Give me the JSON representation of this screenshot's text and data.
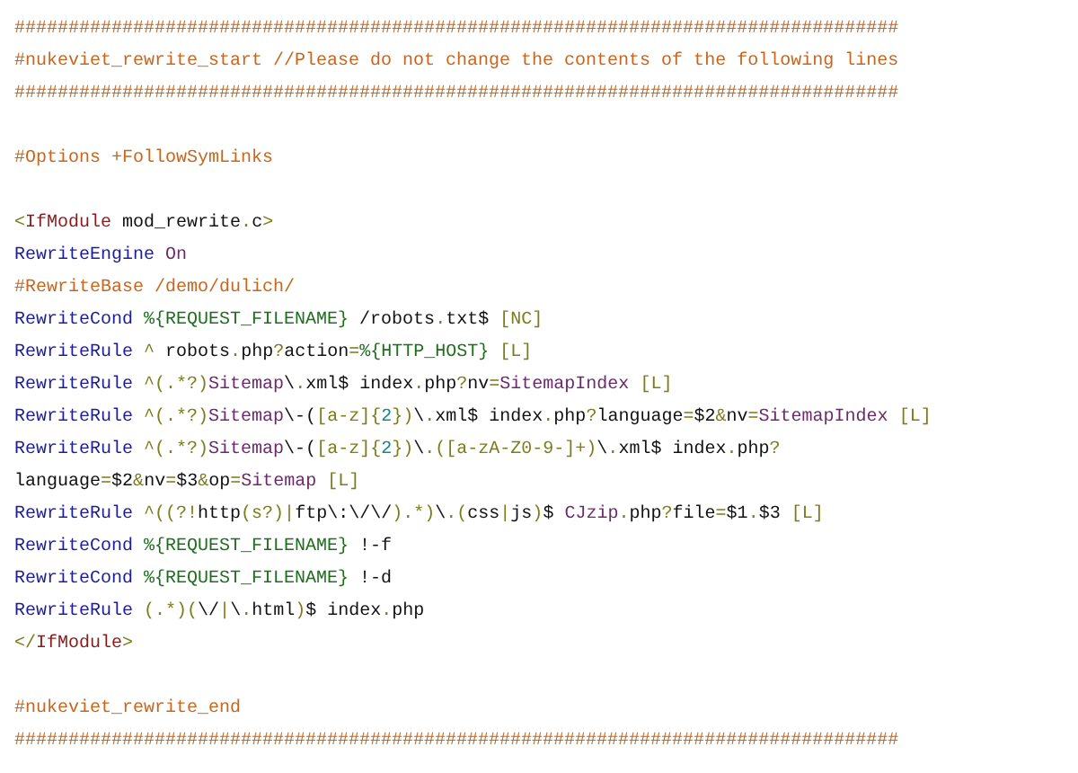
{
  "code": {
    "lines": [
      {
        "kind": "code",
        "tokens": [
          {
            "kind": "comment",
            "text": "##################################################################################"
          }
        ]
      },
      {
        "kind": "code",
        "tokens": [
          {
            "kind": "comment",
            "text": "#nukeviet_rewrite_start //Please do not change the contents of the following lines"
          }
        ]
      },
      {
        "kind": "code",
        "tokens": [
          {
            "kind": "comment",
            "text": "##################################################################################"
          }
        ]
      },
      {
        "kind": "blank"
      },
      {
        "kind": "code",
        "tokens": [
          {
            "kind": "comment",
            "text": "#Options +FollowSymLinks"
          }
        ]
      },
      {
        "kind": "blank"
      },
      {
        "kind": "code",
        "tokens": [
          {
            "kind": "punct",
            "text": "<"
          },
          {
            "kind": "tag",
            "text": "IfModule"
          },
          {
            "kind": "text",
            "text": " mod_rewrite"
          },
          {
            "kind": "punct",
            "text": "."
          },
          {
            "kind": "text",
            "text": "c"
          },
          {
            "kind": "punct",
            "text": ">"
          }
        ]
      },
      {
        "kind": "code",
        "tokens": [
          {
            "kind": "directive",
            "text": "RewriteEngine"
          },
          {
            "kind": "const",
            "text": " On"
          }
        ]
      },
      {
        "kind": "code",
        "tokens": [
          {
            "kind": "comment",
            "text": "#RewriteBase /demo/dulich/"
          }
        ]
      },
      {
        "kind": "code",
        "tokens": [
          {
            "kind": "directive",
            "text": "RewriteCond"
          },
          {
            "kind": "var",
            "text": " %{REQUEST_FILENAME}"
          },
          {
            "kind": "text",
            "text": " /robots"
          },
          {
            "kind": "punct",
            "text": "."
          },
          {
            "kind": "text",
            "text": "txt$"
          },
          {
            "kind": "punct",
            "text": " [NC]"
          }
        ]
      },
      {
        "kind": "code",
        "tokens": [
          {
            "kind": "directive",
            "text": "RewriteRule"
          },
          {
            "kind": "punct",
            "text": " ^"
          },
          {
            "kind": "text",
            "text": " robots"
          },
          {
            "kind": "punct",
            "text": "."
          },
          {
            "kind": "text",
            "text": "php"
          },
          {
            "kind": "punct",
            "text": "?"
          },
          {
            "kind": "text",
            "text": "action"
          },
          {
            "kind": "punct",
            "text": "="
          },
          {
            "kind": "var",
            "text": "%{HTTP_HOST}"
          },
          {
            "kind": "punct",
            "text": " [L]"
          }
        ]
      },
      {
        "kind": "code",
        "tokens": [
          {
            "kind": "directive",
            "text": "RewriteRule"
          },
          {
            "kind": "punct",
            "text": " ^(.*?)"
          },
          {
            "kind": "const",
            "text": "Sitemap"
          },
          {
            "kind": "text",
            "text": "\\"
          },
          {
            "kind": "punct",
            "text": "."
          },
          {
            "kind": "text",
            "text": "xml$ index"
          },
          {
            "kind": "punct",
            "text": "."
          },
          {
            "kind": "text",
            "text": "php"
          },
          {
            "kind": "punct",
            "text": "?"
          },
          {
            "kind": "text",
            "text": "nv"
          },
          {
            "kind": "punct",
            "text": "="
          },
          {
            "kind": "const",
            "text": "SitemapIndex"
          },
          {
            "kind": "punct",
            "text": " [L]"
          }
        ]
      },
      {
        "kind": "code",
        "tokens": [
          {
            "kind": "directive",
            "text": "RewriteRule"
          },
          {
            "kind": "punct",
            "text": " ^(.*?)"
          },
          {
            "kind": "const",
            "text": "Sitemap"
          },
          {
            "kind": "text",
            "text": "\\-("
          },
          {
            "kind": "punct",
            "text": "[a-z]{"
          },
          {
            "kind": "number",
            "text": "2"
          },
          {
            "kind": "punct",
            "text": "})"
          },
          {
            "kind": "text",
            "text": "\\"
          },
          {
            "kind": "punct",
            "text": "."
          },
          {
            "kind": "text",
            "text": "xml$ index"
          },
          {
            "kind": "punct",
            "text": "."
          },
          {
            "kind": "text",
            "text": "php"
          },
          {
            "kind": "punct",
            "text": "?"
          },
          {
            "kind": "text",
            "text": "language"
          },
          {
            "kind": "punct",
            "text": "="
          },
          {
            "kind": "text",
            "text": "$2"
          },
          {
            "kind": "punct",
            "text": "&"
          },
          {
            "kind": "text",
            "text": "nv"
          },
          {
            "kind": "punct",
            "text": "="
          },
          {
            "kind": "const",
            "text": "SitemapIndex"
          },
          {
            "kind": "punct",
            "text": " [L]"
          }
        ]
      },
      {
        "kind": "code",
        "tokens": [
          {
            "kind": "directive",
            "text": "RewriteRule"
          },
          {
            "kind": "punct",
            "text": " ^(.*?)"
          },
          {
            "kind": "const",
            "text": "Sitemap"
          },
          {
            "kind": "text",
            "text": "\\-("
          },
          {
            "kind": "punct",
            "text": "[a-z]{"
          },
          {
            "kind": "number",
            "text": "2"
          },
          {
            "kind": "punct",
            "text": "})"
          },
          {
            "kind": "text",
            "text": "\\"
          },
          {
            "kind": "punct",
            "text": ".("
          },
          {
            "kind": "punct",
            "text": "[a-zA-Z0-9-]+)"
          },
          {
            "kind": "text",
            "text": "\\"
          },
          {
            "kind": "punct",
            "text": "."
          },
          {
            "kind": "text",
            "text": "xml$ index"
          },
          {
            "kind": "punct",
            "text": "."
          },
          {
            "kind": "text",
            "text": "php"
          },
          {
            "kind": "punct",
            "text": "?"
          }
        ]
      },
      {
        "kind": "code",
        "tokens": [
          {
            "kind": "text",
            "text": "language"
          },
          {
            "kind": "punct",
            "text": "="
          },
          {
            "kind": "text",
            "text": "$2"
          },
          {
            "kind": "punct",
            "text": "&"
          },
          {
            "kind": "text",
            "text": "nv"
          },
          {
            "kind": "punct",
            "text": "="
          },
          {
            "kind": "text",
            "text": "$3"
          },
          {
            "kind": "punct",
            "text": "&"
          },
          {
            "kind": "text",
            "text": "op"
          },
          {
            "kind": "punct",
            "text": "="
          },
          {
            "kind": "const",
            "text": "Sitemap"
          },
          {
            "kind": "punct",
            "text": " [L]"
          }
        ]
      },
      {
        "kind": "code",
        "tokens": [
          {
            "kind": "directive",
            "text": "RewriteRule"
          },
          {
            "kind": "punct",
            "text": " ^((?!"
          },
          {
            "kind": "text",
            "text": "http"
          },
          {
            "kind": "punct",
            "text": "(s?)|"
          },
          {
            "kind": "text",
            "text": "ftp\\:\\/\\/"
          },
          {
            "kind": "punct",
            "text": ").*)"
          },
          {
            "kind": "text",
            "text": "\\"
          },
          {
            "kind": "punct",
            "text": ".("
          },
          {
            "kind": "text",
            "text": "css"
          },
          {
            "kind": "punct",
            "text": "|"
          },
          {
            "kind": "text",
            "text": "js"
          },
          {
            "kind": "punct",
            "text": ")"
          },
          {
            "kind": "text",
            "text": "$"
          },
          {
            "kind": "const",
            "text": " CJzip"
          },
          {
            "kind": "punct",
            "text": "."
          },
          {
            "kind": "text",
            "text": "php"
          },
          {
            "kind": "punct",
            "text": "?"
          },
          {
            "kind": "text",
            "text": "file"
          },
          {
            "kind": "punct",
            "text": "="
          },
          {
            "kind": "text",
            "text": "$1"
          },
          {
            "kind": "punct",
            "text": "."
          },
          {
            "kind": "text",
            "text": "$3"
          },
          {
            "kind": "punct",
            "text": " [L]"
          }
        ]
      },
      {
        "kind": "code",
        "tokens": [
          {
            "kind": "directive",
            "text": "RewriteCond"
          },
          {
            "kind": "var",
            "text": " %{REQUEST_FILENAME}"
          },
          {
            "kind": "text",
            "text": " !-f"
          }
        ]
      },
      {
        "kind": "code",
        "tokens": [
          {
            "kind": "directive",
            "text": "RewriteCond"
          },
          {
            "kind": "var",
            "text": " %{REQUEST_FILENAME}"
          },
          {
            "kind": "text",
            "text": " !-d"
          }
        ]
      },
      {
        "kind": "code",
        "tokens": [
          {
            "kind": "directive",
            "text": "RewriteRule"
          },
          {
            "kind": "punct",
            "text": " (.*)("
          },
          {
            "kind": "text",
            "text": "\\/"
          },
          {
            "kind": "punct",
            "text": "|"
          },
          {
            "kind": "text",
            "text": "\\"
          },
          {
            "kind": "punct",
            "text": "."
          },
          {
            "kind": "text",
            "text": "html"
          },
          {
            "kind": "punct",
            "text": ")"
          },
          {
            "kind": "text",
            "text": "$ index"
          },
          {
            "kind": "punct",
            "text": "."
          },
          {
            "kind": "text",
            "text": "php"
          }
        ]
      },
      {
        "kind": "code",
        "tokens": [
          {
            "kind": "punct",
            "text": "</"
          },
          {
            "kind": "tag",
            "text": "IfModule"
          },
          {
            "kind": "punct",
            "text": ">"
          }
        ]
      },
      {
        "kind": "blank"
      },
      {
        "kind": "code",
        "tokens": [
          {
            "kind": "comment",
            "text": "#nukeviet_rewrite_end"
          }
        ]
      },
      {
        "kind": "code",
        "tokens": [
          {
            "kind": "comment",
            "text": "##################################################################################"
          }
        ]
      }
    ]
  }
}
